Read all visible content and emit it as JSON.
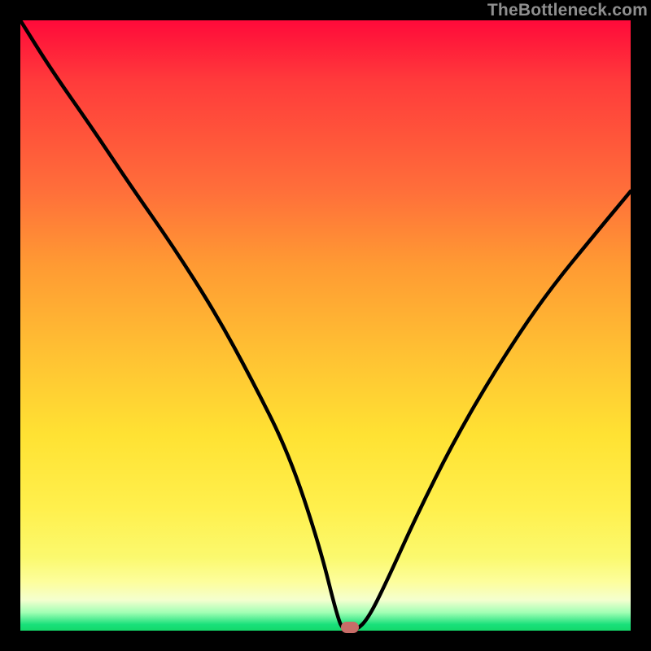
{
  "watermark": "TheBottleneck.com",
  "chart_data": {
    "type": "line",
    "title": "",
    "xlabel": "",
    "ylabel": "",
    "xlim": [
      0,
      100
    ],
    "ylim": [
      0,
      100
    ],
    "grid": false,
    "series": [
      {
        "name": "bottleneck-curve",
        "x": [
          0,
          5,
          12,
          18,
          25,
          32,
          38,
          44,
          49,
          52,
          53,
          55,
          57,
          60,
          65,
          71,
          78,
          86,
          95,
          100
        ],
        "values": [
          100,
          92,
          82,
          73,
          63,
          52,
          41,
          29,
          14,
          2,
          0,
          0,
          2,
          8,
          19,
          31,
          43,
          55,
          66,
          72
        ]
      }
    ],
    "marker": {
      "x": 54,
      "y": 0,
      "color": "#c86d68"
    },
    "background_gradient": {
      "type": "vertical",
      "stops": [
        {
          "pos": 0.0,
          "color": "#ff0a3a"
        },
        {
          "pos": 0.4,
          "color": "#ff9a33"
        },
        {
          "pos": 0.8,
          "color": "#fff04d"
        },
        {
          "pos": 0.95,
          "color": "#f4ffcf"
        },
        {
          "pos": 1.0,
          "color": "#14d96a"
        }
      ]
    }
  }
}
